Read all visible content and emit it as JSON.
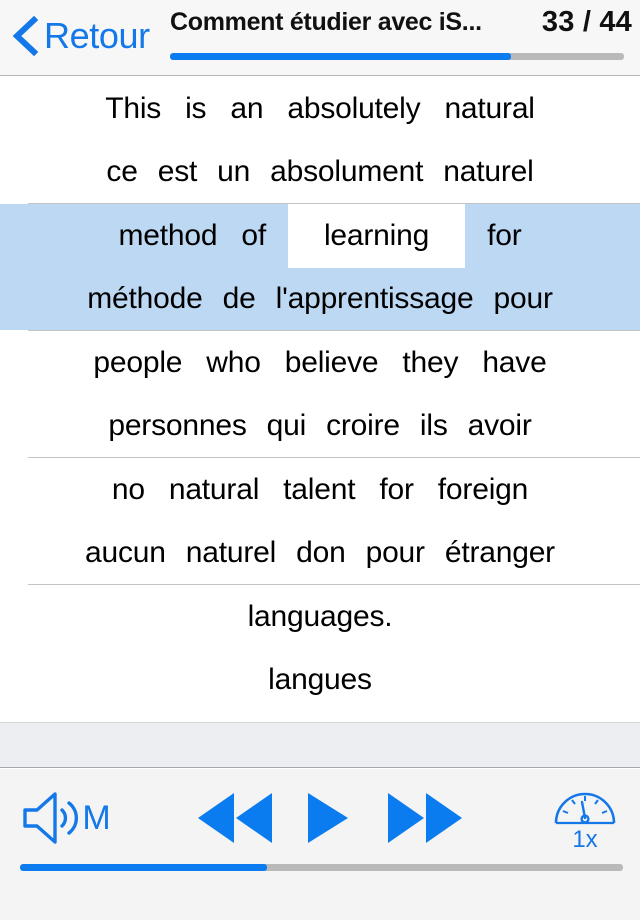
{
  "header": {
    "back_label": "Retour",
    "back_icon": "chevron-left-icon",
    "title": "Comment étudier avec iS...",
    "counter": "33 / 44",
    "progress_percent": 75,
    "accent_color": "#0a7cf0",
    "link_color": "#1578e8"
  },
  "content": {
    "highlight_color": "#bcd8f3",
    "rows": [
      {
        "highlighted": false,
        "source": [
          "This",
          "is",
          "an",
          "absolutely",
          "natural"
        ],
        "target": [
          "ce",
          "est",
          "un",
          "absolument",
          "naturel"
        ],
        "active_word": null
      },
      {
        "highlighted": true,
        "source": [
          "method",
          "of",
          "learning",
          "for"
        ],
        "target": [
          "méthode",
          "de",
          "l'apprentissage",
          "pour"
        ],
        "active_word": "learning"
      },
      {
        "highlighted": false,
        "source": [
          "people",
          "who",
          "believe",
          "they",
          "have"
        ],
        "target": [
          "personnes",
          "qui",
          "croire",
          "ils",
          "avoir"
        ],
        "active_word": null
      },
      {
        "highlighted": false,
        "source": [
          "no",
          "natural",
          "talent",
          "for",
          "foreign"
        ],
        "target": [
          "aucun",
          "naturel",
          "don",
          "pour",
          "étranger"
        ],
        "active_word": null
      },
      {
        "highlighted": false,
        "source": [
          "languages."
        ],
        "target": [
          "langues"
        ],
        "active_word": null
      }
    ]
  },
  "toolbar": {
    "volume_icon": "speaker-wave-icon",
    "volume_mode_label": "M",
    "rewind_icon": "rewind-icon",
    "play_icon": "play-icon",
    "fast_forward_icon": "fast-forward-icon",
    "speed_icon": "speedometer-icon",
    "speed_label": "1x",
    "playback_progress_percent": 41
  }
}
